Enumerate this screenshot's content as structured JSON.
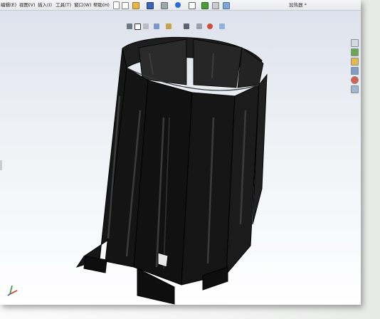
{
  "menu": {
    "items": [
      "编辑(E)",
      "视图(V)",
      "插入(I)",
      "工具(T)",
      "窗口(W)",
      "帮助(H)"
    ]
  },
  "document": {
    "title": "加热器 *"
  },
  "toolbar_icons": [
    "new-document-icon",
    "open-icon",
    "save-icon",
    "print-icon",
    "undo-icon",
    "select-icon",
    "rebuild-icon",
    "options-icon"
  ],
  "view_tools": [
    "zoom-to-fit-icon",
    "zoom-area-icon",
    "previous-view-icon",
    "section-view-icon",
    "view-orientation-icon",
    "display-style-icon",
    "hide-show-icon",
    "appearance-icon",
    "scene-icon"
  ],
  "taskpane_icons": [
    "home-icon",
    "design-library-icon",
    "file-explorer-icon",
    "view-palette-icon",
    "appearances-icon",
    "custom-properties-icon"
  ],
  "colors": {
    "model": "#101010",
    "background_top": "#dde2ec",
    "background_bottom": "#ffffff"
  }
}
